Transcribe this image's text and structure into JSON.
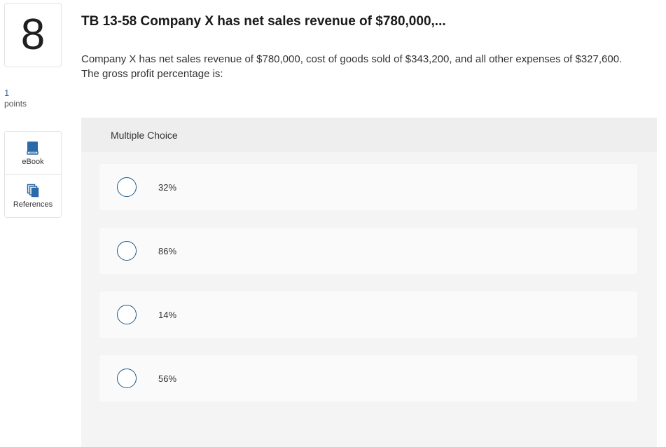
{
  "question": {
    "number": "8",
    "points_value": "1",
    "points_label": "points",
    "title": "TB 13-58 Company X has net sales revenue of $780,000,...",
    "body_line1": "Company X has net sales revenue of $780,000, cost of goods sold of $343,200, and all other expenses of $327,600.",
    "body_line2": "The gross profit percentage is:"
  },
  "tools": [
    {
      "label": "eBook",
      "icon": "book-icon",
      "color": "#2a6aa8"
    },
    {
      "label": "References",
      "icon": "copy-documents-icon",
      "color": "#2a6aa8"
    }
  ],
  "multiple_choice": {
    "header": "Multiple Choice",
    "options": [
      "32%",
      "86%",
      "14%",
      "56%"
    ]
  },
  "colors": {
    "accent": "#2a6aa8",
    "radio_border": "#1f5a8a",
    "panel_bg": "#f4f4f4"
  }
}
